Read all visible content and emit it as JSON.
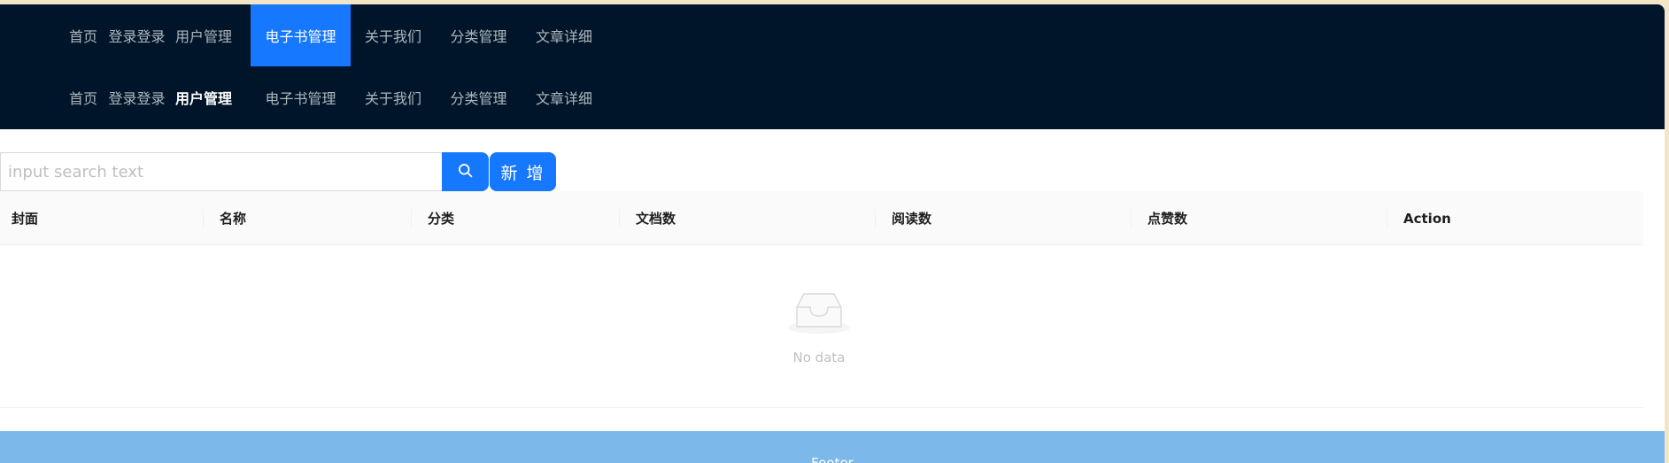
{
  "nav_top": {
    "items": [
      {
        "label": "首页"
      },
      {
        "label": "登录登录"
      },
      {
        "label": "用户管理"
      },
      {
        "label": "电子书管理"
      },
      {
        "label": "关于我们"
      },
      {
        "label": "分类管理"
      },
      {
        "label": "文章详细"
      }
    ],
    "selected": "电子书管理"
  },
  "nav_bottom": {
    "items": [
      {
        "label": "首页"
      },
      {
        "label": "登录登录"
      },
      {
        "label": "用户管理"
      },
      {
        "label": "电子书管理"
      },
      {
        "label": "关于我们"
      },
      {
        "label": "分类管理"
      },
      {
        "label": "文章详细"
      }
    ],
    "selected": "用户管理"
  },
  "search": {
    "placeholder": "input search text",
    "value": "",
    "icon": "search-icon"
  },
  "toolbar": {
    "add_label": "新 增"
  },
  "table": {
    "columns": [
      "封面",
      "名称",
      "分类",
      "文档数",
      "阅读数",
      "点赞数",
      "Action"
    ],
    "rows": [],
    "empty_text": "No data",
    "empty_icon": "inbox-icon"
  },
  "footer": {
    "text": "Footer"
  },
  "colors": {
    "header_bg": "#001529",
    "primary": "#1677ff",
    "footer_bg": "#7cb8ea"
  }
}
